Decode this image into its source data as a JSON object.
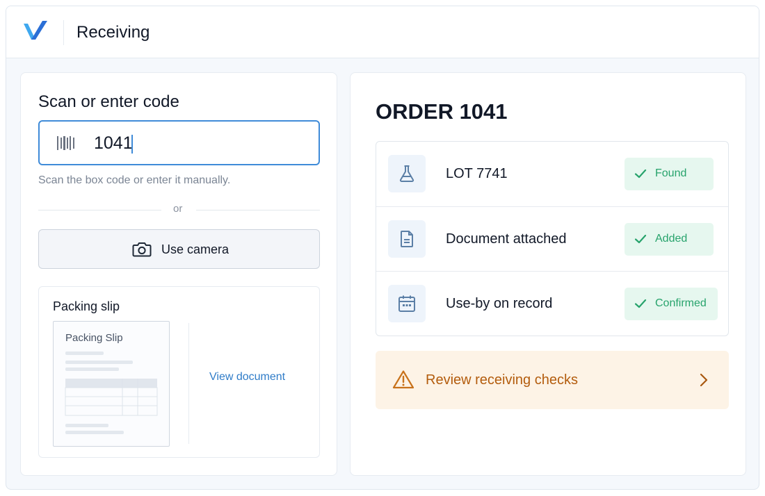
{
  "header": {
    "title": "Receiving",
    "logo_icon": "v-logo-icon"
  },
  "scan": {
    "title": "Scan or enter code",
    "input_value": "1041",
    "helper": "Scan the box code or enter it manually.",
    "or": "or",
    "camera_label": "Use camera"
  },
  "slip": {
    "title": "Packing slip",
    "thumb_title": "Packing Slip",
    "view_link": "View document"
  },
  "order": {
    "title": "ORDER 1041",
    "checks": [
      {
        "icon": "flask-icon",
        "label": "LOT 7741",
        "status": "Found"
      },
      {
        "icon": "document-icon",
        "label": "Document attached",
        "status": "Added"
      },
      {
        "icon": "calendar-icon",
        "label": "Use-by on record",
        "status": "Confirmed"
      }
    ],
    "warning": "Review receiving checks"
  },
  "colors": {
    "accent": "#3f8bd8",
    "success": "#27a36c",
    "success_bg": "#e6f7ef",
    "warning": "#b35c0d",
    "warning_bg": "#fdf3e6"
  }
}
